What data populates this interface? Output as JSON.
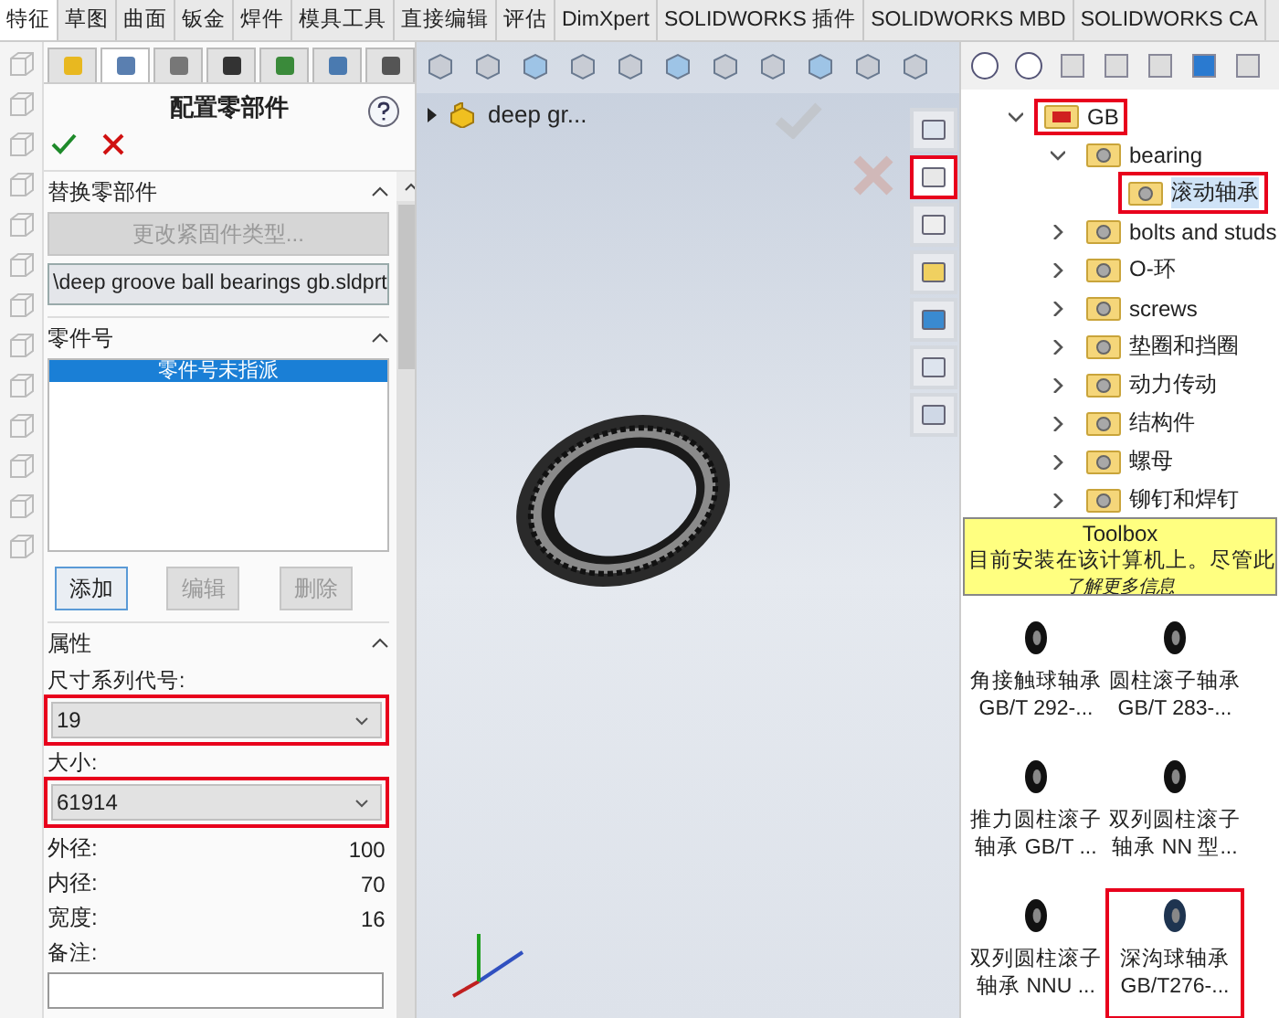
{
  "menu_tabs": [
    {
      "label": "特征",
      "selected": true
    },
    {
      "label": "草图",
      "selected": false
    },
    {
      "label": "曲面",
      "selected": false
    },
    {
      "label": "钣金",
      "selected": false
    },
    {
      "label": "焊件",
      "selected": false
    },
    {
      "label": "模具工具",
      "selected": false
    },
    {
      "label": "直接编辑",
      "selected": false
    },
    {
      "label": "评估",
      "selected": false
    },
    {
      "label": "DimXpert",
      "selected": false
    },
    {
      "label": "SOLIDWORKS 插件",
      "selected": false
    },
    {
      "label": "SOLIDWORKS MBD",
      "selected": false
    },
    {
      "label": "SOLIDWORKS CA",
      "selected": false
    }
  ],
  "manager_tabs": [
    {
      "selected": false
    },
    {
      "selected": true
    },
    {
      "selected": false
    },
    {
      "selected": false
    },
    {
      "selected": false
    },
    {
      "selected": false
    },
    {
      "selected": false
    }
  ],
  "property_manager": {
    "title": "配置零部件",
    "replace_section": {
      "title": "替换零部件",
      "button": {
        "label": "更改紧固件类型...",
        "disabled": true
      },
      "file_field": {
        "value": "\\deep groove ball bearings gb.sldprt"
      }
    },
    "part_number_section": {
      "title": "零件号",
      "list": [
        {
          "label": "零件号未指派",
          "selected": true
        }
      ],
      "buttons": [
        {
          "label": "添加",
          "disabled": false
        },
        {
          "label": "编辑",
          "disabled": true
        },
        {
          "label": "删除",
          "disabled": true
        }
      ]
    },
    "properties_section": {
      "title": "属性",
      "fields": [
        {
          "kind": "dropdown",
          "label": "尺寸系列代号:",
          "value": "19",
          "highlighted": true
        },
        {
          "kind": "dropdown",
          "label": "大小:",
          "value": "61914",
          "highlighted": true
        },
        {
          "kind": "value",
          "label": "外径:",
          "value": "100"
        },
        {
          "kind": "value",
          "label": "内径:",
          "value": "70"
        },
        {
          "kind": "value",
          "label": "宽度:",
          "value": "16"
        },
        {
          "kind": "input",
          "label": "备注:"
        }
      ]
    }
  },
  "viewport": {
    "tree_item": "deep gr...",
    "side_tabs": [
      {
        "highlighted": false
      },
      {
        "highlighted": true
      },
      {
        "highlighted": false
      },
      {
        "highlighted": false
      },
      {
        "highlighted": false
      },
      {
        "highlighted": false
      },
      {
        "highlighted": false
      }
    ]
  },
  "design_library": {
    "tree": [
      {
        "label": "GB",
        "expanded": true,
        "highlighted": true,
        "selected": false,
        "children": [
          {
            "label": "bearing",
            "expanded": true,
            "highlighted": false,
            "selected": false,
            "children": [
              {
                "label": "滚动轴承",
                "kind": "leaf",
                "highlighted": true,
                "selected": true
              }
            ]
          },
          {
            "label": "bolts and studs",
            "expanded": false,
            "highlighted": false,
            "selected": false
          },
          {
            "label": "O-环",
            "expanded": false,
            "highlighted": false,
            "selected": false
          },
          {
            "label": "screws",
            "expanded": false,
            "highlighted": false,
            "selected": false
          },
          {
            "label": "垫圈和挡圈",
            "expanded": false,
            "highlighted": false,
            "selected": false
          },
          {
            "label": "动力传动",
            "expanded": false,
            "highlighted": false,
            "selected": false
          },
          {
            "label": "结构件",
            "expanded": false,
            "highlighted": false,
            "selected": false
          },
          {
            "label": "螺母",
            "expanded": false,
            "highlighted": false,
            "selected": false
          },
          {
            "label": "铆钉和焊钉",
            "expanded": false,
            "highlighted": false,
            "selected": false
          }
        ]
      }
    ],
    "toolbox": {
      "title": "Toolbox",
      "message": "目前安装在该计算机上。尽管此",
      "link": "了解更多信息"
    },
    "tiles": [
      {
        "lines": [
          "角接触球轴承",
          "GB/T 292-..."
        ],
        "highlighted": false
      },
      {
        "lines": [
          "圆柱滚子轴承",
          "GB/T 283-..."
        ],
        "highlighted": false
      },
      {
        "lines": [
          "推力圆柱滚子",
          "轴承 GB/T ..."
        ],
        "highlighted": false
      },
      {
        "lines": [
          "双列圆柱滚子",
          "轴承 NN 型..."
        ],
        "highlighted": false
      },
      {
        "lines": [
          "双列圆柱滚子",
          "轴承 NNU ..."
        ],
        "highlighted": false
      },
      {
        "lines": [
          "深沟球轴承",
          "GB/T276-..."
        ],
        "highlighted": true
      }
    ]
  }
}
